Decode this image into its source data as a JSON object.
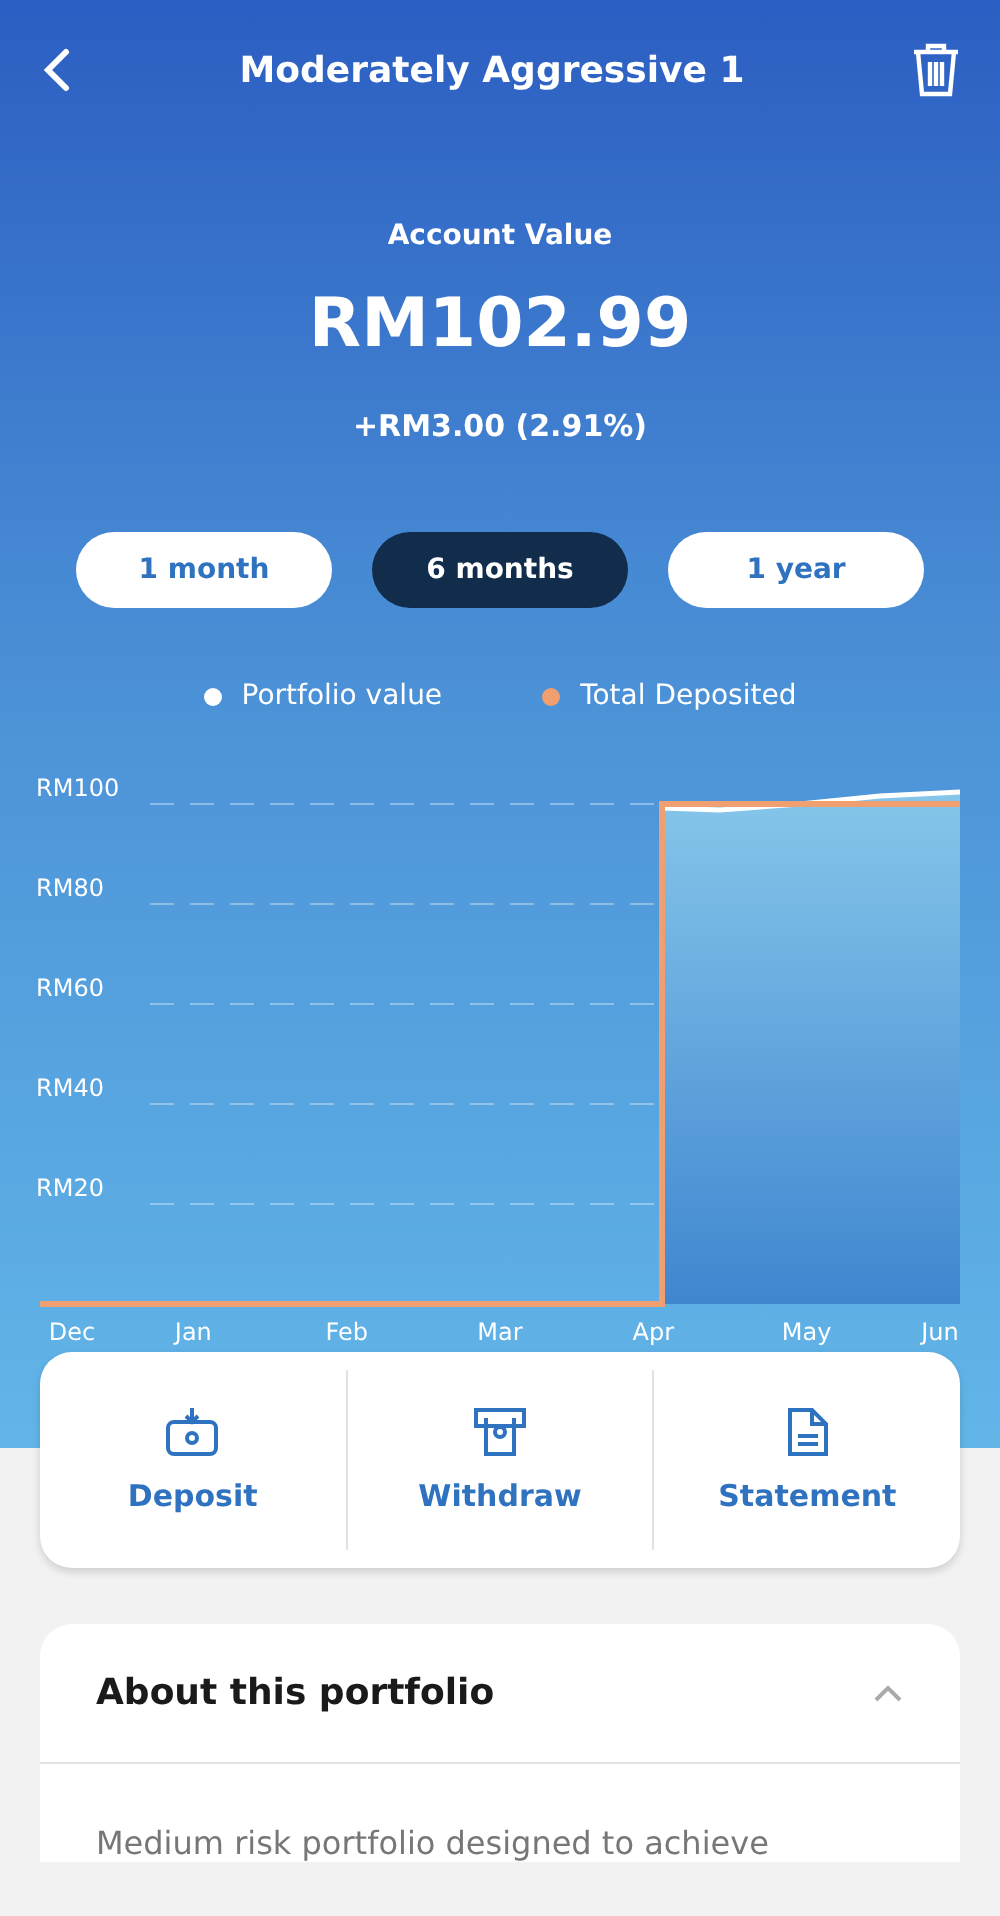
{
  "header": {
    "title": "Moderately Aggressive 1"
  },
  "account": {
    "label": "Account Value",
    "value": "RM102.99",
    "change": "+RM3.00 (2.91%)"
  },
  "periods": [
    {
      "label": "1 month",
      "selected": false
    },
    {
      "label": "6 months",
      "selected": true
    },
    {
      "label": "1 year",
      "selected": false
    }
  ],
  "chart": {
    "legend": [
      {
        "name": "Portfolio value",
        "color": "#ffffff"
      },
      {
        "name": "Total Deposited",
        "color": "#f0a070"
      }
    ],
    "y_labels": [
      "RM100",
      "RM80",
      "RM60",
      "RM40",
      "RM20"
    ],
    "x_labels": [
      "Dec",
      "Jan",
      "Feb",
      "Mar",
      "Apr",
      "May",
      "Jun"
    ]
  },
  "actions": [
    {
      "label": "Deposit",
      "kind": "deposit"
    },
    {
      "label": "Withdraw",
      "kind": "withdraw"
    },
    {
      "label": "Statement",
      "kind": "statement"
    }
  ],
  "about": {
    "title": "About this portfolio",
    "expanded": true,
    "text": "Medium risk portfolio designed to achieve"
  }
}
